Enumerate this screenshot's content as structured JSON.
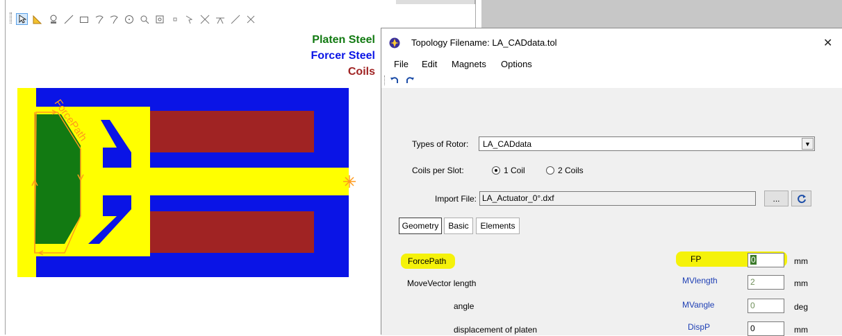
{
  "cad": {
    "toolbar_icons": [
      "select-arrow-icon",
      "triangle-icon",
      "view-icon",
      "line-icon",
      "rectangle-icon",
      "arc-icon",
      "arc2-icon",
      "circle-icon",
      "zoom-icon",
      "zoom-fit-icon",
      "point-icon",
      "pointer-icon",
      "cross-arrows-icon",
      "split-icon",
      "diagonal-icon",
      "delete-x-icon"
    ],
    "legend": {
      "platen": "Platen Steel",
      "forcer": "Forcer Steel",
      "coils": "Coils"
    },
    "force_path_label": "ForcePath",
    "colors": {
      "platen": "#127a12",
      "forcer": "#0a14e6",
      "coils": "#a02323",
      "air": "#ffff00",
      "path": "#ff9a1a"
    }
  },
  "dialog": {
    "title": "Topology Filename: LA_CADdata.tol",
    "close_symbol": "✕",
    "menu": [
      "File",
      "Edit",
      "Magnets",
      "Options"
    ],
    "toolbar": [
      "undo-icon",
      "redo-icon"
    ],
    "rotor_label": "Types of Rotor:",
    "rotor_value": "LA_CADdata",
    "coils_label": "Coils per Slot:",
    "coils_options": [
      "1 Coil",
      "2 Coils"
    ],
    "coils_selected": "1 Coil",
    "import_label": "Import File:",
    "import_value": "LA_Actuator_0°.dxf",
    "browse_label": "...",
    "tabs": [
      "Geometry",
      "Basic",
      "Elements"
    ],
    "selected_tab": "Geometry",
    "params": [
      {
        "label": "ForcePath",
        "var": "FP",
        "value": "0",
        "unit": "mm"
      },
      {
        "label": "MoveVector length",
        "var": "MVlength",
        "value": "2",
        "unit": "mm"
      },
      {
        "label": "angle",
        "var": "MVangle",
        "value": "0",
        "unit": "deg"
      },
      {
        "label": "displacement of platen",
        "var": "DispP",
        "value": "0",
        "unit": "mm"
      }
    ]
  }
}
